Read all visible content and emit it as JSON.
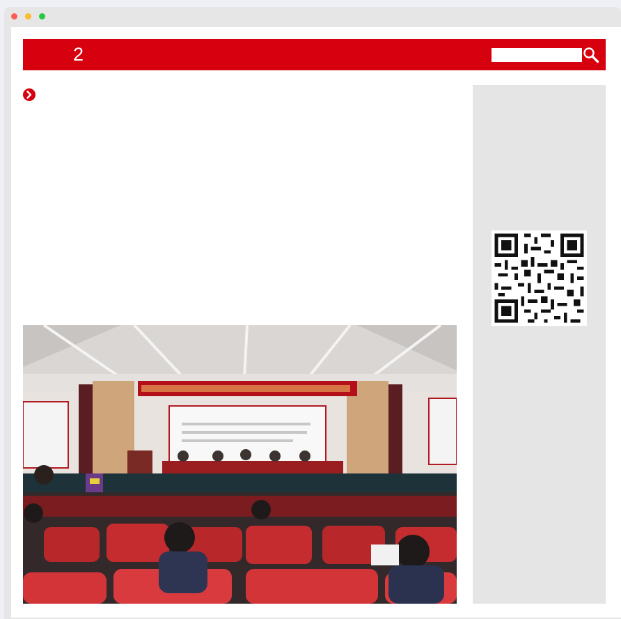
{
  "header": {
    "logo_text": "2",
    "brand_color": "#d7000f",
    "search": {
      "placeholder": "",
      "value": "",
      "icon": "magnifier-icon"
    }
  },
  "content": {
    "bullet_icon": "chevron-right-circle-icon",
    "photo": {
      "description_icon": "meeting-hall-photo"
    }
  },
  "sidebar": {
    "qr_icon": "qr-code-icon"
  }
}
